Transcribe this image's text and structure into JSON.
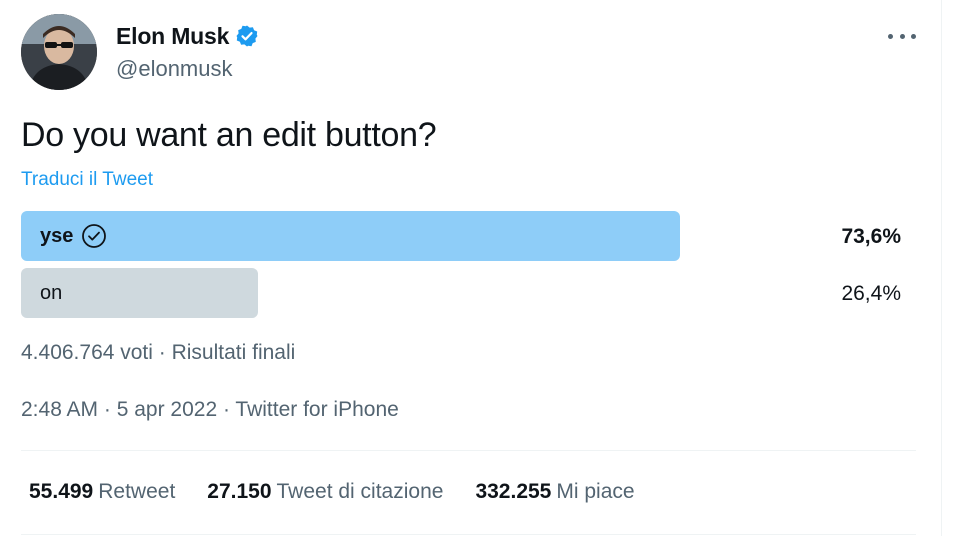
{
  "author": {
    "display_name": "Elon Musk",
    "handle": "@elonmusk",
    "verified": true,
    "verified_color": "#1d9bf0"
  },
  "tweet": {
    "text": "Do you want an edit button?",
    "translate_label": "Traduci il Tweet"
  },
  "poll": {
    "options": [
      {
        "label": "yse",
        "percent": "73,6%",
        "fraction": 0.736,
        "winner": true,
        "color": "#8ecdf8"
      },
      {
        "label": "on",
        "percent": "26,4%",
        "fraction": 0.264,
        "winner": false,
        "color": "#cfd9de"
      }
    ],
    "meta": "4.406.764 voti · Risultati finali"
  },
  "timestamp": "2:48 AM · 5 apr 2022 · Twitter for iPhone",
  "stats": {
    "retweets_count": "55.499",
    "retweets_label": "Retweet",
    "quotes_count": "27.150",
    "quotes_label": "Tweet di citazione",
    "likes_count": "332.255",
    "likes_label": "Mi piace"
  },
  "icons": {
    "more": "more-horizontal-icon",
    "verified": "verified-badge-icon",
    "winner": "check-circle-icon"
  }
}
